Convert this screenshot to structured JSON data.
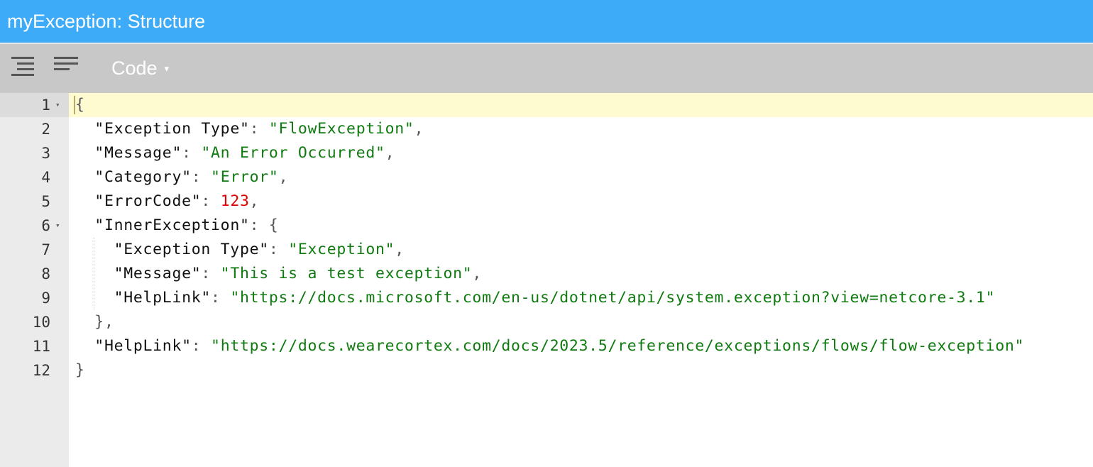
{
  "title": "myException: Structure",
  "toolbar": {
    "format_icon": "format-json-icon",
    "compact_icon": "compact-json-icon",
    "mode_label": "Code",
    "mode_caret": "▾"
  },
  "editor": {
    "active_line": 1,
    "gutter": [
      {
        "num": "1",
        "fold": "▾"
      },
      {
        "num": "2",
        "fold": ""
      },
      {
        "num": "3",
        "fold": ""
      },
      {
        "num": "4",
        "fold": ""
      },
      {
        "num": "5",
        "fold": ""
      },
      {
        "num": "6",
        "fold": "▾"
      },
      {
        "num": "7",
        "fold": ""
      },
      {
        "num": "8",
        "fold": ""
      },
      {
        "num": "9",
        "fold": ""
      },
      {
        "num": "10",
        "fold": ""
      },
      {
        "num": "11",
        "fold": ""
      },
      {
        "num": "12",
        "fold": ""
      }
    ],
    "lines": [
      [
        {
          "t": "{",
          "c": "p"
        }
      ],
      [
        {
          "t": "  ",
          "c": "k"
        },
        {
          "t": "\"Exception Type\"",
          "c": "k"
        },
        {
          "t": ": ",
          "c": "p"
        },
        {
          "t": "\"FlowException\"",
          "c": "s"
        },
        {
          "t": ",",
          "c": "p"
        }
      ],
      [
        {
          "t": "  ",
          "c": "k"
        },
        {
          "t": "\"Message\"",
          "c": "k"
        },
        {
          "t": ": ",
          "c": "p"
        },
        {
          "t": "\"An Error Occurred\"",
          "c": "s"
        },
        {
          "t": ",",
          "c": "p"
        }
      ],
      [
        {
          "t": "  ",
          "c": "k"
        },
        {
          "t": "\"Category\"",
          "c": "k"
        },
        {
          "t": ": ",
          "c": "p"
        },
        {
          "t": "\"Error\"",
          "c": "s"
        },
        {
          "t": ",",
          "c": "p"
        }
      ],
      [
        {
          "t": "  ",
          "c": "k"
        },
        {
          "t": "\"ErrorCode\"",
          "c": "k"
        },
        {
          "t": ": ",
          "c": "p"
        },
        {
          "t": "123",
          "c": "n"
        },
        {
          "t": ",",
          "c": "p"
        }
      ],
      [
        {
          "t": "  ",
          "c": "k"
        },
        {
          "t": "\"InnerException\"",
          "c": "k"
        },
        {
          "t": ": {",
          "c": "p"
        }
      ],
      [
        {
          "t": "    ",
          "c": "k"
        },
        {
          "t": "\"Exception Type\"",
          "c": "k"
        },
        {
          "t": ": ",
          "c": "p"
        },
        {
          "t": "\"Exception\"",
          "c": "s"
        },
        {
          "t": ",",
          "c": "p"
        }
      ],
      [
        {
          "t": "    ",
          "c": "k"
        },
        {
          "t": "\"Message\"",
          "c": "k"
        },
        {
          "t": ": ",
          "c": "p"
        },
        {
          "t": "\"This is a test exception\"",
          "c": "s"
        },
        {
          "t": ",",
          "c": "p"
        }
      ],
      [
        {
          "t": "    ",
          "c": "k"
        },
        {
          "t": "\"HelpLink\"",
          "c": "k"
        },
        {
          "t": ": ",
          "c": "p"
        },
        {
          "t": "\"https://docs.microsoft.com/en-us/dotnet/api/system.exception?view=netcore-3.1\"",
          "c": "s"
        }
      ],
      [
        {
          "t": "  ",
          "c": "k"
        },
        {
          "t": "},",
          "c": "p"
        }
      ],
      [
        {
          "t": "  ",
          "c": "k"
        },
        {
          "t": "\"HelpLink\"",
          "c": "k"
        },
        {
          "t": ": ",
          "c": "p"
        },
        {
          "t": "\"https://docs.wearecortex.com/docs/2023.5/reference/exceptions/flows/flow-exception\"",
          "c": "s"
        }
      ],
      [
        {
          "t": "}",
          "c": "p"
        }
      ]
    ]
  },
  "colors": {
    "titlebar": "#3dabf7",
    "toolbar": "#c8c8c8",
    "gutter": "#ebebeb",
    "active_line": "#fffbd1",
    "string": "#0f7a0f",
    "number": "#e00000"
  }
}
